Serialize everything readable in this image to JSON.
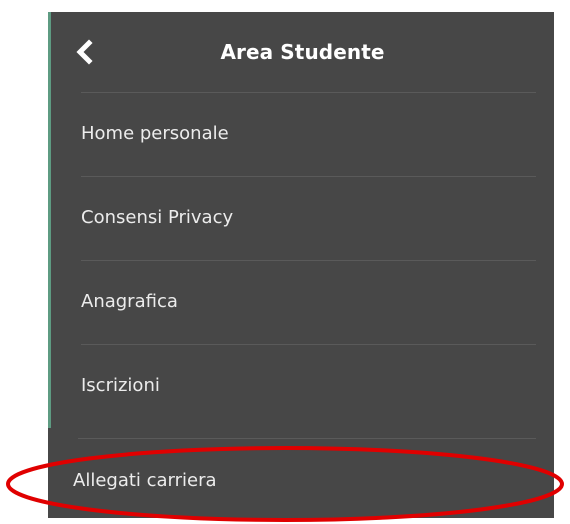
{
  "menu": {
    "title": "Area Studente",
    "items": [
      {
        "label": "Home personale"
      },
      {
        "label": "Consensi Privacy"
      },
      {
        "label": "Anagrafica"
      },
      {
        "label": "Iscrizioni"
      }
    ],
    "bottom_item": {
      "label": "Allegati carriera"
    }
  },
  "colors": {
    "panel_bg": "#474747",
    "accent_border": "#5e9b82",
    "highlight_ellipse": "#e00000",
    "text": "#ececec"
  },
  "icons": {
    "back": "chevron-left-icon"
  }
}
